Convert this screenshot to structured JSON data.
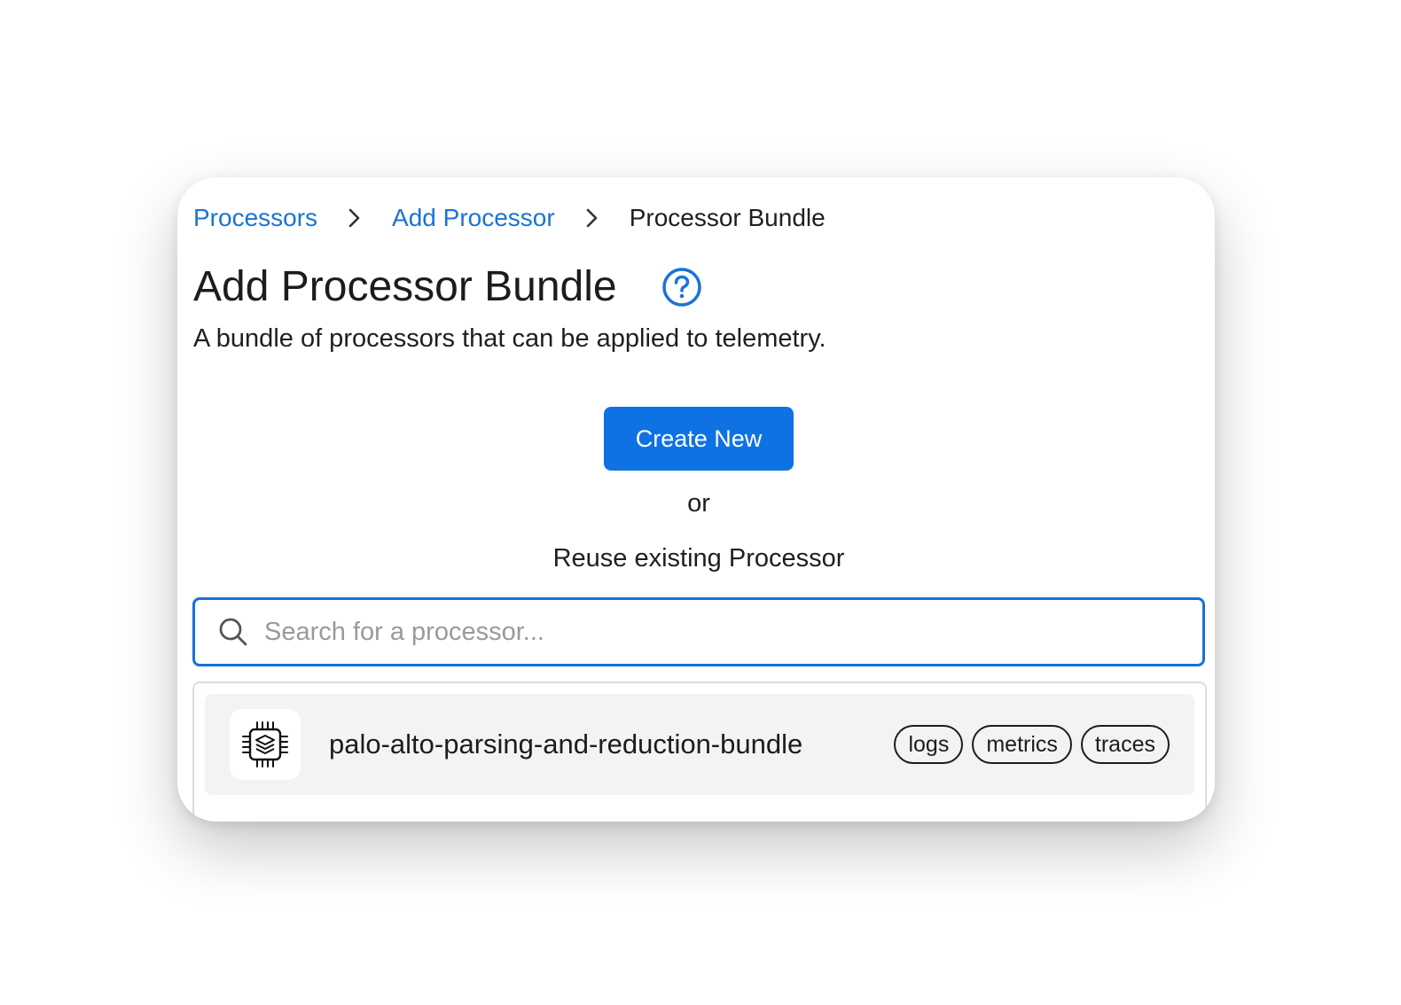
{
  "breadcrumb": {
    "items": [
      "Processors",
      "Add Processor"
    ],
    "current": "Processor Bundle"
  },
  "header": {
    "title": "Add Processor Bundle",
    "subtitle": "A bundle of processors that can be applied to telemetry."
  },
  "actions": {
    "create_label": "Create New",
    "or_label": "or",
    "reuse_label": "Reuse existing Processor"
  },
  "search": {
    "placeholder": "Search for a processor...",
    "value": ""
  },
  "results": [
    {
      "name": "palo-alto-parsing-and-reduction-bundle",
      "icon": "processor-bundle-chip-icon",
      "tags": [
        "logs",
        "metrics",
        "traces"
      ]
    }
  ],
  "colors": {
    "accent": "#0f72e4",
    "link": "#1a73d8",
    "text": "#1c1c1c",
    "result_bg": "#f3f3f3"
  }
}
